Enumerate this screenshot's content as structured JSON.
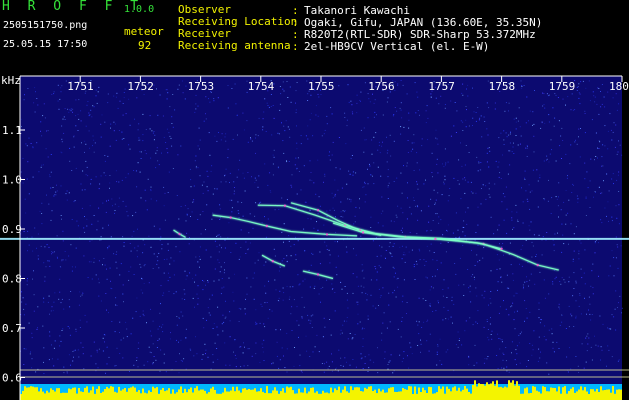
{
  "header": {
    "app_title": "H R O F F T",
    "app_version": "1.0.0",
    "file_name": "2505151750.png",
    "timestamp": "25.05.15 17:50",
    "meteor_label": "meteor",
    "meteor_count": "92"
  },
  "info": [
    {
      "label": "Observer",
      "value": "Takanori Kawachi"
    },
    {
      "label": "Receiving Location",
      "value": "Ogaki, Gifu, JAPAN (136.60E, 35.35N)"
    },
    {
      "label": "Receiver",
      "value": "R820T2(RTL-SDR) SDR-Sharp 53.372MHz"
    },
    {
      "label": "Receiving antenna",
      "value": "2el-HB9CV Vertical (el. E-W)"
    }
  ],
  "info_separator": ":",
  "chart_data": {
    "type": "heatmap",
    "title": "",
    "ylabel": "kHz",
    "x_ticks": [
      "1751",
      "1752",
      "1753",
      "1754",
      "1755",
      "1756",
      "1757",
      "1758",
      "1759",
      "1800"
    ],
    "y_ticks": [
      "1.1",
      "1.0",
      "0.9",
      "0.8",
      "0.7",
      "0.6"
    ],
    "x_range": [
      "1750",
      "1800"
    ],
    "ylim": [
      0.59,
      1.2
    ],
    "carrier_khz": 0.88,
    "traces": [
      {
        "name": "trace-1",
        "points": [
          [
            1752.55,
            0.898
          ],
          [
            1752.65,
            0.89
          ],
          [
            1752.75,
            0.883
          ]
        ]
      },
      {
        "name": "trace-2",
        "points": [
          [
            1753.2,
            0.928
          ],
          [
            1753.5,
            0.923
          ],
          [
            1753.8,
            0.915
          ],
          [
            1754.1,
            0.906
          ],
          [
            1754.5,
            0.895
          ],
          [
            1755.1,
            0.889
          ],
          [
            1755.6,
            0.886
          ]
        ]
      },
      {
        "name": "trace-3",
        "points": [
          [
            1753.95,
            0.948
          ],
          [
            1754.4,
            0.947
          ],
          [
            1754.9,
            0.928
          ],
          [
            1755.4,
            0.907
          ],
          [
            1755.9,
            0.891
          ],
          [
            1756.4,
            0.884
          ],
          [
            1757.0,
            0.881
          ],
          [
            1757.7,
            0.87
          ],
          [
            1758.2,
            0.848
          ],
          [
            1758.6,
            0.827
          ],
          [
            1758.95,
            0.817
          ]
        ]
      },
      {
        "name": "trace-4",
        "points": [
          [
            1754.5,
            0.953
          ],
          [
            1754.95,
            0.938
          ],
          [
            1755.3,
            0.916
          ],
          [
            1755.65,
            0.897
          ],
          [
            1756.0,
            0.887
          ]
        ]
      },
      {
        "name": "trace-5",
        "points": [
          [
            1755.2,
            0.912
          ],
          [
            1755.7,
            0.893
          ],
          [
            1756.3,
            0.884
          ],
          [
            1756.9,
            0.88
          ],
          [
            1757.6,
            0.872
          ],
          [
            1758.0,
            0.86
          ]
        ]
      },
      {
        "name": "trace-6",
        "points": [
          [
            1754.02,
            0.847
          ],
          [
            1754.2,
            0.835
          ],
          [
            1754.4,
            0.825
          ]
        ]
      },
      {
        "name": "trace-7",
        "points": [
          [
            1754.7,
            0.815
          ],
          [
            1754.95,
            0.808
          ],
          [
            1755.2,
            0.8
          ]
        ]
      }
    ],
    "guide_lines_khz": [
      0.618,
      0.605
    ],
    "colors": {
      "background": "#0c0a70",
      "carrier": "#7fe7ff",
      "trace": "#7cffc6",
      "trace_hot": "#ff4bd6",
      "spectrum": "#f4f400",
      "axis": "#ffffff"
    }
  }
}
